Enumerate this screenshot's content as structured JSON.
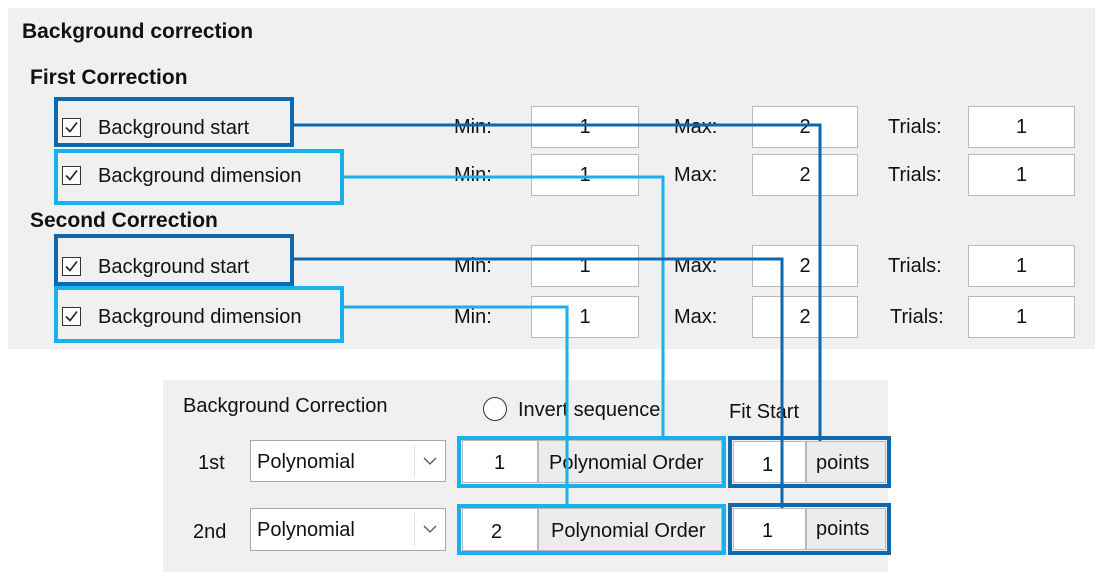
{
  "top_panel": {
    "title": "Background correction",
    "first_correction": {
      "heading": "First Correction",
      "rows": [
        {
          "checkbox_label": "Background start",
          "checked": true,
          "min_label": "Min:",
          "min_value": "1",
          "max_label": "Max:",
          "max_value": "2",
          "trials_label": "Trials:",
          "trials_value": "1"
        },
        {
          "checkbox_label": "Background dimension",
          "checked": true,
          "min_label": "Min:",
          "min_value": "1",
          "max_label": "Max:",
          "max_value": "2",
          "trials_label": "Trials:",
          "trials_value": "1"
        }
      ]
    },
    "second_correction": {
      "heading": "Second Correction",
      "rows": [
        {
          "checkbox_label": "Background start",
          "checked": true,
          "min_label": "Min:",
          "min_value": "1",
          "max_label": "Max:",
          "max_value": "2",
          "trials_label": "Trials:",
          "trials_value": "1"
        },
        {
          "checkbox_label": "Background dimension",
          "checked": true,
          "min_label": "Min:",
          "min_value": "1",
          "max_label": "Max:",
          "max_value": "2",
          "trials_label": "Trials:",
          "trials_value": "1"
        }
      ]
    }
  },
  "bottom_panel": {
    "title": "Background Correction",
    "invert_label": "Invert sequence",
    "fit_start_label": "Fit Start",
    "rows": [
      {
        "label": "1st",
        "method": "Polynomial",
        "order_value": "1",
        "order_label": "Polynomial Order",
        "fit_value": "1",
        "fit_unit": "points"
      },
      {
        "label": "2nd",
        "method": "Polynomial",
        "order_value": "2",
        "order_label": "Polynomial Order",
        "fit_value": "1",
        "fit_unit": "points"
      }
    ]
  },
  "colors": {
    "dark_highlight": "#0e68b0",
    "light_highlight": "#1ab0ea",
    "panel_bg": "#f0f0f0"
  }
}
